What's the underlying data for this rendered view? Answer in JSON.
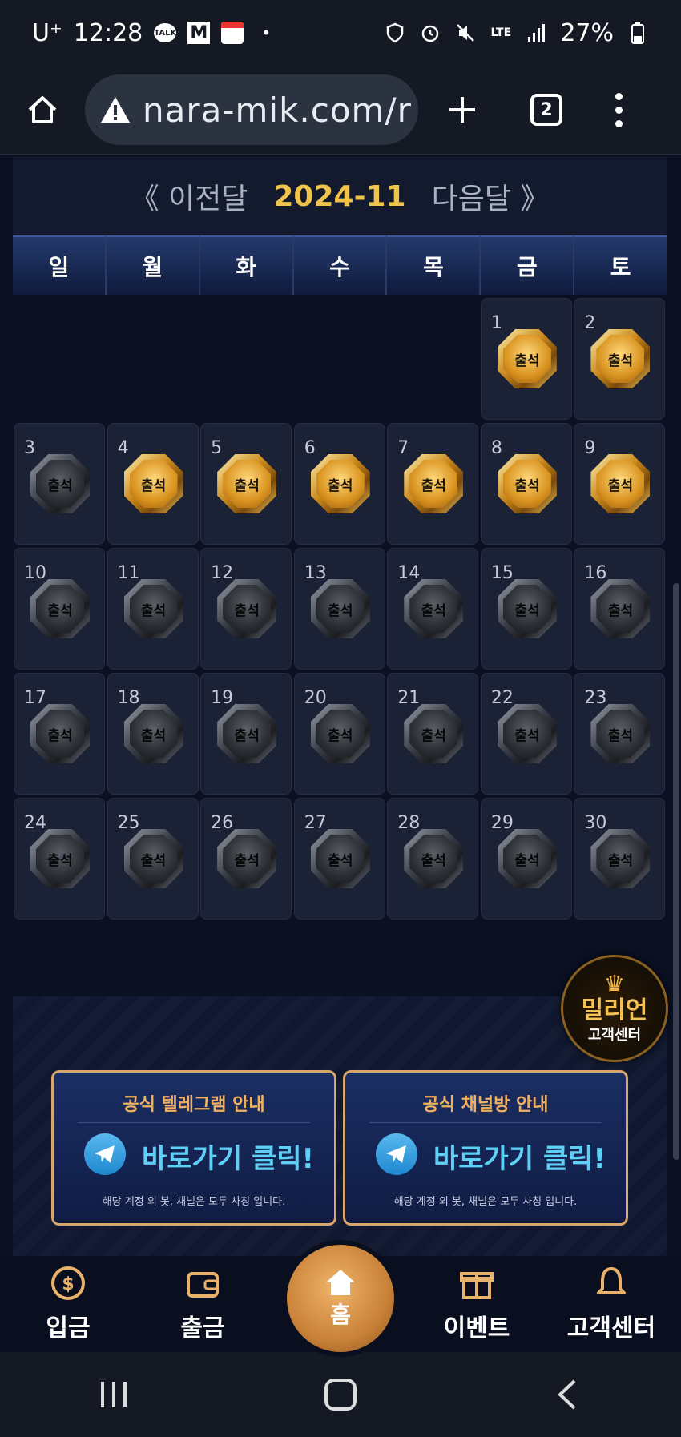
{
  "status_bar": {
    "carrier": "U⁺",
    "time": "12:28",
    "battery": "27%",
    "network": "LTE",
    "notification_icons": [
      "talk-icon",
      "gmail-icon",
      "calendar-icon",
      "dot-icon"
    ],
    "system_icons": [
      "vpn-icon",
      "alarm-icon",
      "mute-icon",
      "lte-icon",
      "signal-icon",
      "battery-icon"
    ]
  },
  "browser": {
    "url": "nara-mik.com/r",
    "tab_count": "2"
  },
  "calendar": {
    "prev_label": "《 이전달",
    "month": "2024-11",
    "next_label": "다음달 》",
    "weekdays": [
      "일",
      "월",
      "화",
      "수",
      "목",
      "금",
      "토"
    ],
    "badge_label": "출석",
    "days": [
      {
        "d": "1",
        "checked": true
      },
      {
        "d": "2",
        "checked": true
      },
      {
        "d": "3",
        "checked": false
      },
      {
        "d": "4",
        "checked": true
      },
      {
        "d": "5",
        "checked": true
      },
      {
        "d": "6",
        "checked": true
      },
      {
        "d": "7",
        "checked": true
      },
      {
        "d": "8",
        "checked": true
      },
      {
        "d": "9",
        "checked": true
      },
      {
        "d": "10",
        "checked": false
      },
      {
        "d": "11",
        "checked": false
      },
      {
        "d": "12",
        "checked": false
      },
      {
        "d": "13",
        "checked": false
      },
      {
        "d": "14",
        "checked": false
      },
      {
        "d": "15",
        "checked": false
      },
      {
        "d": "16",
        "checked": false
      },
      {
        "d": "17",
        "checked": false
      },
      {
        "d": "18",
        "checked": false
      },
      {
        "d": "19",
        "checked": false
      },
      {
        "d": "20",
        "checked": false
      },
      {
        "d": "21",
        "checked": false
      },
      {
        "d": "22",
        "checked": false
      },
      {
        "d": "23",
        "checked": false
      },
      {
        "d": "24",
        "checked": false
      },
      {
        "d": "25",
        "checked": false
      },
      {
        "d": "26",
        "checked": false
      },
      {
        "d": "27",
        "checked": false
      },
      {
        "d": "28",
        "checked": false
      },
      {
        "d": "29",
        "checked": false
      },
      {
        "d": "30",
        "checked": false
      }
    ],
    "first_weekday_index": 5
  },
  "promos": {
    "telegram": {
      "title": "공식 텔레그램 안내",
      "button": "바로가기 클릭!",
      "note": "해당 계정 외 봇, 채널은 모두 사칭 입니다."
    },
    "channel": {
      "title": "공식 채널방 안내",
      "button": "바로가기 클릭!",
      "note": "해당 계정 외 봇, 채널은 모두 사칭 입니다."
    }
  },
  "cs_float": {
    "brand": "밀리언",
    "sub": "고객센터"
  },
  "bottom_nav": {
    "deposit": "입금",
    "withdraw": "출금",
    "home": "홈",
    "event": "이벤트",
    "support": "고객센터"
  },
  "colors": {
    "gold": "#f0c44a",
    "page_bg": "#0b1022",
    "cell_bg": "#1c2236",
    "accent_cyan": "#5fd0f5"
  }
}
